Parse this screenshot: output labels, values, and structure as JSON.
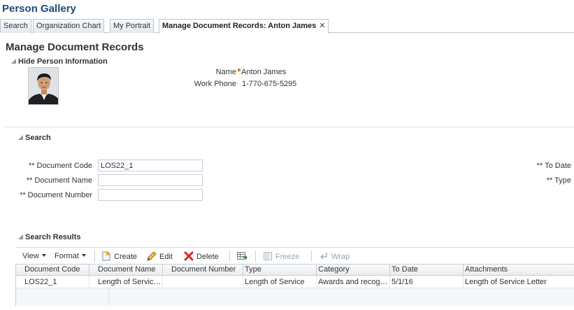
{
  "app": {
    "title": "Person Gallery"
  },
  "tabs": [
    {
      "label": "Search"
    },
    {
      "label": "Organization Chart"
    },
    {
      "label": "My Portrait"
    },
    {
      "label": "Manage Document Records: Anton James",
      "close": "✕"
    }
  ],
  "page": {
    "title": "Manage Document Records"
  },
  "person": {
    "section_label": "Hide Person Information",
    "name_label": "Name",
    "name_value": "Anton James",
    "phone_label": "Work Phone",
    "phone_value": "1-770-675-5295"
  },
  "search": {
    "section_label": "Search",
    "fields": {
      "doc_code_label": "** Document Code",
      "doc_code_value": "LOS22_1",
      "doc_name_label": "** Document Name",
      "doc_name_value": "",
      "doc_number_label": "** Document Number",
      "doc_number_value": "",
      "to_date_label": "** To Date",
      "type_label": "** Type"
    }
  },
  "results": {
    "section_label": "Search Results",
    "toolbar": {
      "view": "View",
      "format": "Format",
      "create": "Create",
      "edit": "Edit",
      "delete": "Delete",
      "freeze": "Freeze",
      "wrap": "Wrap"
    },
    "columns": [
      "Document Code",
      "Document Name",
      "Document Number",
      "Type",
      "Category",
      "To Date",
      "Attachments"
    ],
    "rows": [
      [
        "LOS22_1",
        "Length of Service R...",
        "",
        "Length of Service",
        "Awards and recogn...",
        "5/1/16",
        "Length of Service Letter"
      ]
    ]
  },
  "colors": {
    "title_blue": "#1f4c7a",
    "required_orange": "#e0891c",
    "delete_red": "#d9261c"
  },
  "icons": {
    "create": "create-document-icon",
    "edit": "pencil-icon",
    "delete": "red-x-icon",
    "export": "export-icon",
    "freeze": "freeze-columns-icon",
    "wrap": "wrap-icon"
  }
}
